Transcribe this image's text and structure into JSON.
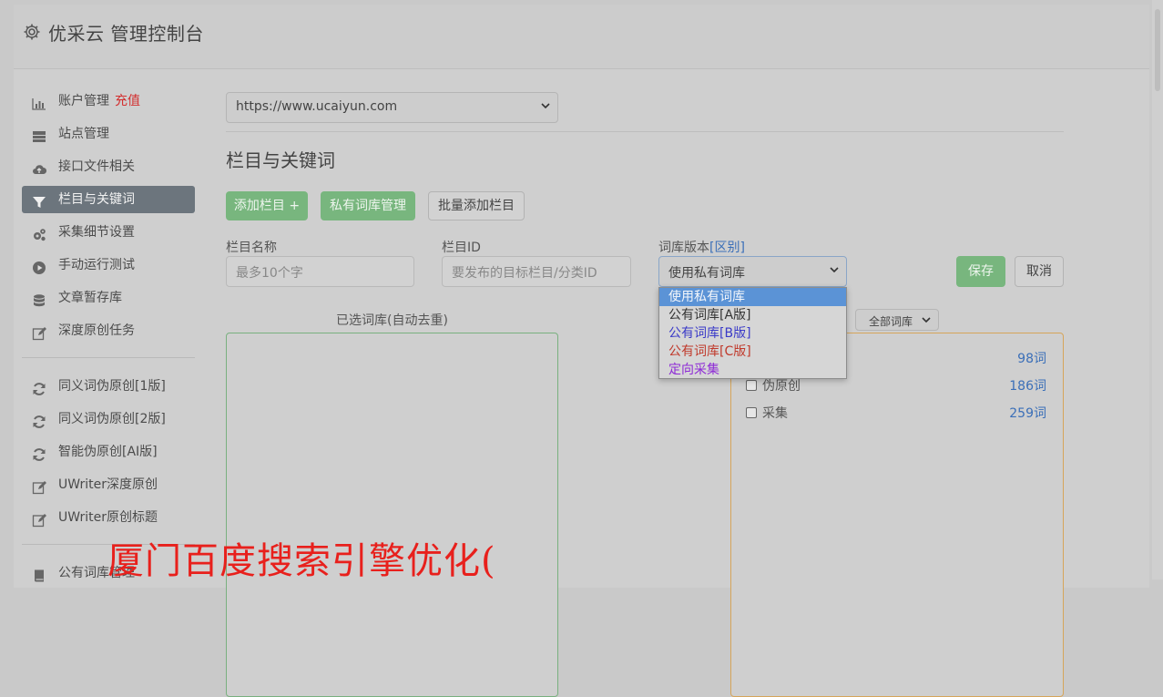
{
  "header": {
    "title": "优采云 管理控制台",
    "icon": "gear-icon"
  },
  "sidebar": {
    "group1": [
      {
        "label": "账户管理",
        "extra": "充值",
        "icon": "bar-chart-icon"
      },
      {
        "label": "站点管理",
        "icon": "server-icon"
      },
      {
        "label": "接口文件相关",
        "icon": "cloud-upload-icon"
      },
      {
        "label": "栏目与关键词",
        "icon": "filter-icon",
        "active": true
      },
      {
        "label": "采集细节设置",
        "icon": "cogs-icon"
      },
      {
        "label": "手动运行测试",
        "icon": "play-circle-icon"
      },
      {
        "label": "文章暂存库",
        "icon": "database-icon"
      },
      {
        "label": "深度原创任务",
        "icon": "edit-icon"
      }
    ],
    "group2": [
      {
        "label": "同义词伪原创[1版]",
        "icon": "refresh-icon"
      },
      {
        "label": "同义词伪原创[2版]",
        "icon": "refresh-icon"
      },
      {
        "label": "智能伪原创[AI版]",
        "icon": "refresh-icon"
      },
      {
        "label": "UWriter深度原创",
        "icon": "edit-icon"
      },
      {
        "label": "UWriter原创标题",
        "icon": "edit-icon"
      }
    ],
    "group3": [
      {
        "label": "公有词库管理",
        "icon": "book-icon"
      }
    ]
  },
  "main": {
    "site_select": {
      "value": "https://www.ucaiyun.com"
    },
    "section_title": "栏目与关键词",
    "buttons": {
      "add": "添加栏目 +",
      "private": "私有词库管理",
      "batch": "批量添加栏目"
    },
    "form": {
      "name_label": "栏目名称",
      "name_placeholder": "最多10个字",
      "id_label": "栏目ID",
      "id_placeholder": "要发布的目标栏目/分类ID",
      "version_label": "词库版本",
      "version_link": "[区别]",
      "version_value": "使用私有词库",
      "save": "保存",
      "cancel": "取消"
    },
    "selected_title": "已选词库(自动去重)",
    "all_select": "全部词库",
    "dropdown": [
      {
        "label": "使用私有词库",
        "selected": true,
        "color": "#f4f7fb"
      },
      {
        "label": "公有词库[A版]",
        "color": "#333333"
      },
      {
        "label": "公有词库[B版]",
        "color": "#3a3ac8"
      },
      {
        "label": "公有词库[C版]",
        "color": "#c0392b"
      },
      {
        "label": "定向采集",
        "color": "#8e2bd6"
      }
    ],
    "library_rows": [
      {
        "label": "",
        "count": "98词"
      },
      {
        "label": "伪原创",
        "count": "186词"
      },
      {
        "label": "采集",
        "count": "259词"
      }
    ]
  },
  "watermark": "厦门百度搜索引擎优化("
}
